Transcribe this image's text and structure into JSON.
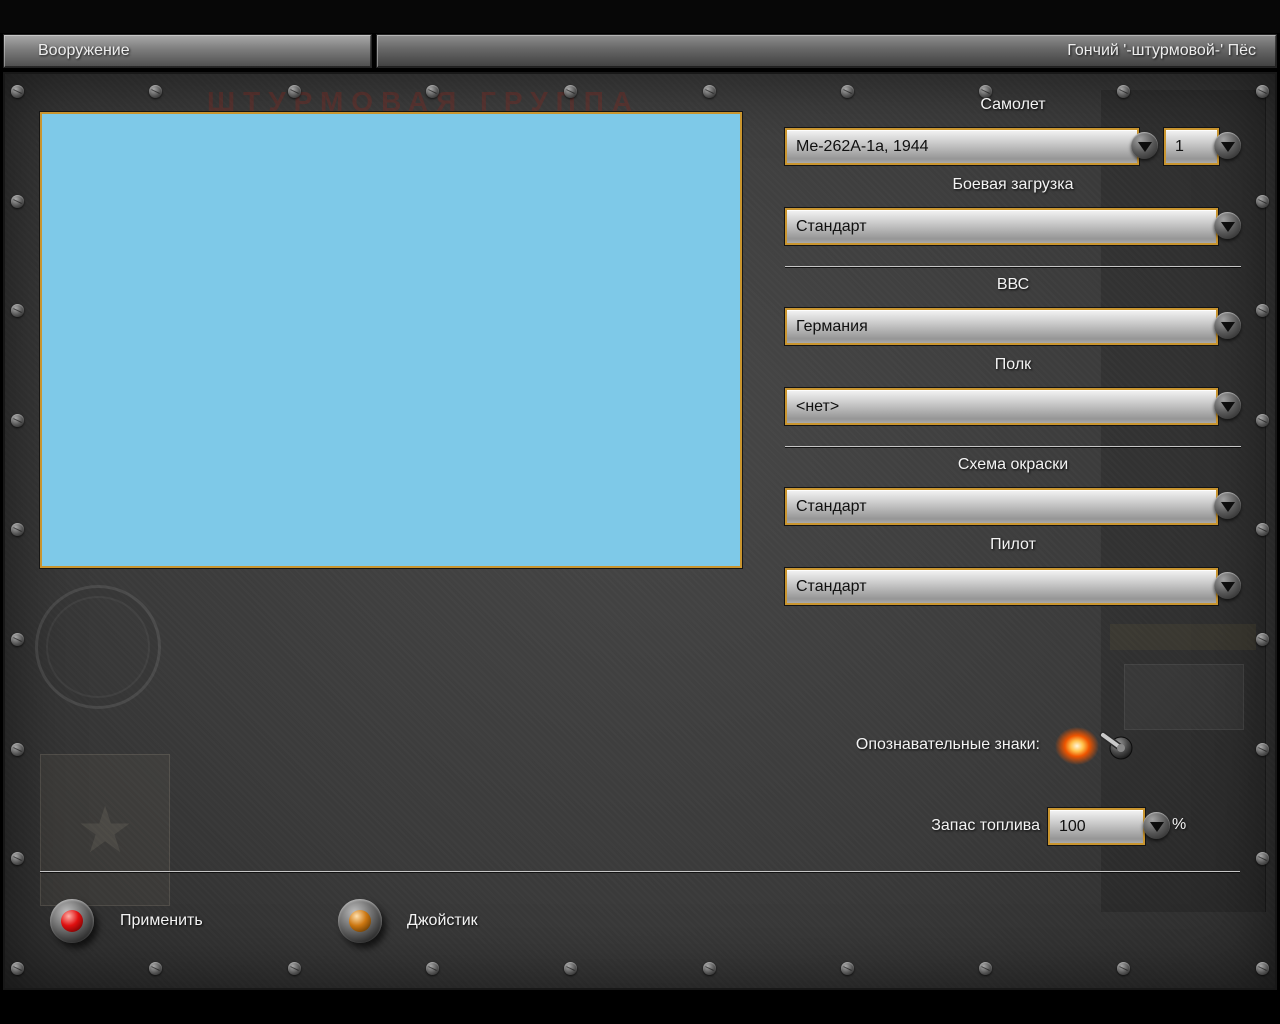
{
  "header": {
    "tab_armament": "Вооружение",
    "title": "Гончий '-штурмовой-' Пёс"
  },
  "aircraft": {
    "label": "Самолет",
    "value": "Me-262A-1a, 1944",
    "count_value": "1"
  },
  "loadout": {
    "label": "Боевая загрузка",
    "value": "Стандарт"
  },
  "airforce": {
    "label": "ВВС",
    "value": "Германия"
  },
  "regiment": {
    "label": "Полк",
    "value": "<нет>"
  },
  "paint_scheme": {
    "label": "Схема окраски",
    "value": "Стандарт"
  },
  "pilot": {
    "label": "Пилот",
    "value": "Стандарт"
  },
  "markings": {
    "label": "Опознавательные знаки:"
  },
  "fuel": {
    "label": "Запас топлива",
    "value": "100",
    "unit": "%"
  },
  "buttons": {
    "apply": "Применить",
    "joystick": "Джойстик"
  },
  "background": {
    "poster_text": "ШТУРМОВАЯ ГРУППА"
  },
  "colors": {
    "accent_border": "#c9952f",
    "preview_sky": "#7ec9e8",
    "lamp_red": "#e01010",
    "lamp_amber": "#cc7711"
  }
}
